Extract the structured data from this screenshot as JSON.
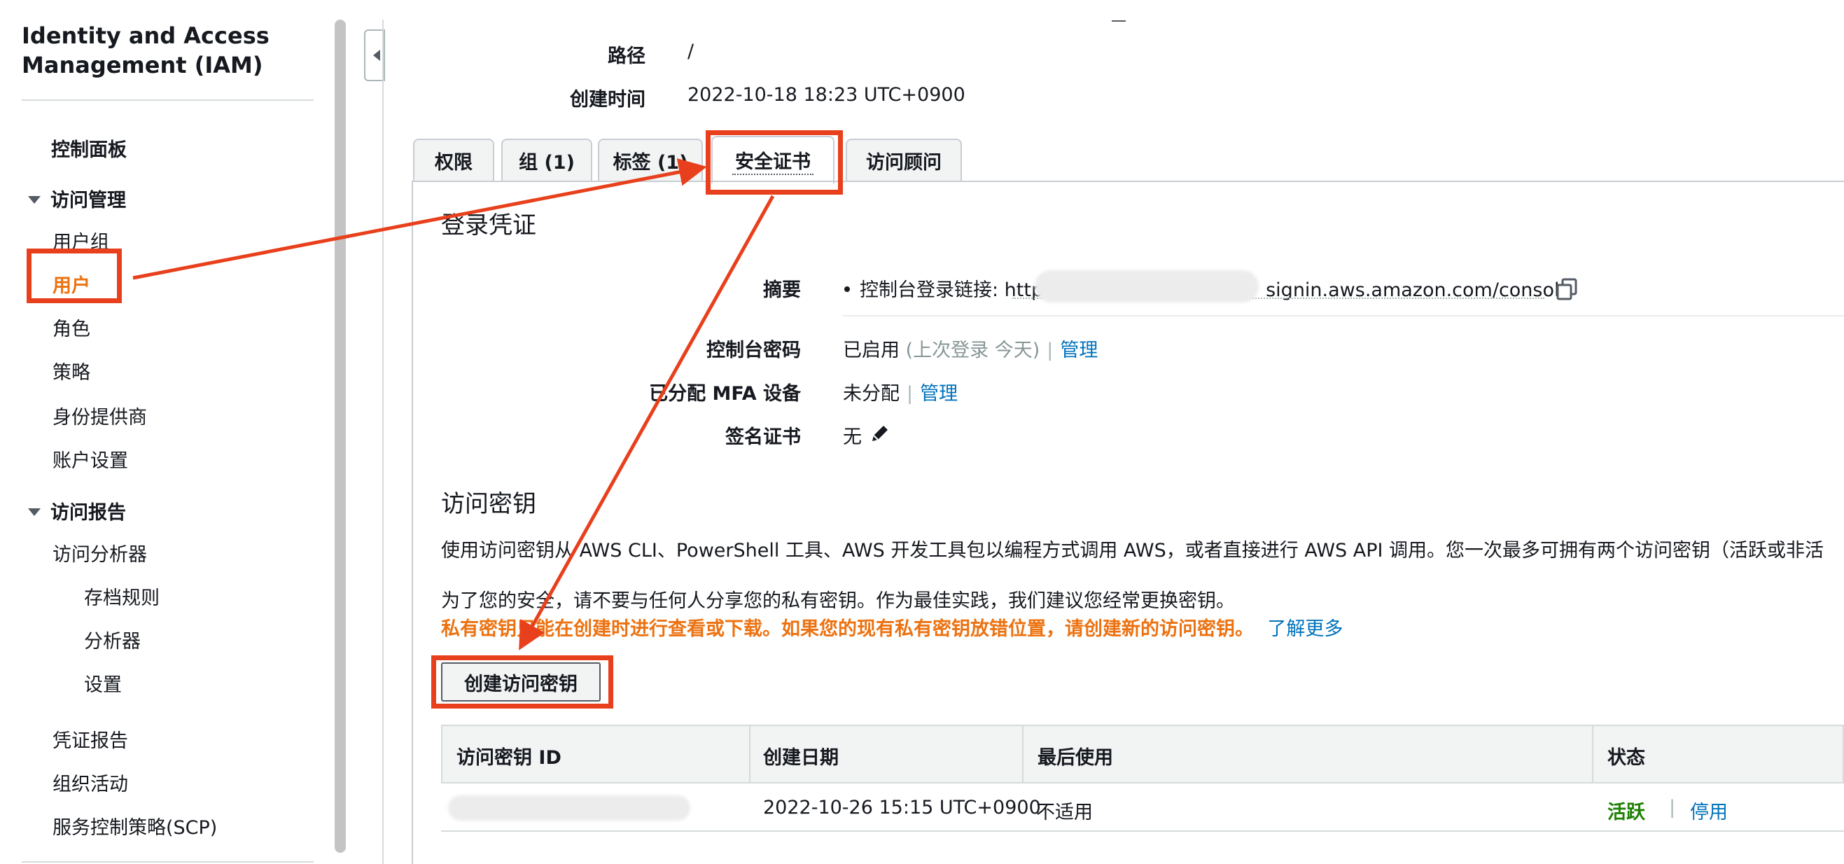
{
  "sidebar": {
    "title_line1": "Identity and Access",
    "title_line2": "Management (IAM)",
    "dashboard": "控制面板",
    "access_management": "访问管理",
    "user_groups": "用户组",
    "users": "用户",
    "roles": "角色",
    "policies": "策略",
    "identity_providers": "身份提供商",
    "account_settings": "账户设置",
    "access_reports": "访问报告",
    "access_analyzer": "访问分析器",
    "archive_rules": "存档规则",
    "analyzers": "分析器",
    "settings": "设置",
    "credential_report": "凭证报告",
    "org_activity": "组织活动",
    "scp": "服务控制策略(SCP)"
  },
  "details": {
    "path_label": "路径",
    "path_value": "/",
    "created_label": "创建时间",
    "created_value": "2022-10-18 18:23 UTC+0900"
  },
  "tabs": [
    {
      "label": "权限"
    },
    {
      "label": "组 (1)"
    },
    {
      "label": "标签 (1)"
    },
    {
      "label": "安全证书"
    },
    {
      "label": "访问顾问"
    }
  ],
  "login_credentials": {
    "heading": "登录凭证",
    "summary_label": "摘要",
    "summary_prefix": "控制台登录链接: http",
    "summary_suffix": "signin.aws.amazon.com/console",
    "console_password_label": "控制台密码",
    "console_password_value": "已启用",
    "console_password_note": "(上次登录 今天)",
    "manage": "管理",
    "sep": "|",
    "mfa_label": "已分配 MFA 设备",
    "mfa_value": "未分配",
    "signing_cert_label": "签名证书",
    "signing_cert_value": "无"
  },
  "access_keys": {
    "heading": "访问密钥",
    "desc": "使用访问密钥从 AWS CLI、PowerShell 工具、AWS 开发工具包以编程方式调用 AWS，或者直接进行 AWS API 调用。您一次最多可拥有两个访问密钥（活跃或非活",
    "security_note": "为了您的安全，请不要与任何人分享您的私有密钥。作为最佳实践，我们建议您经常更换密钥。",
    "warning": "私有密钥只能在创建时进行查看或下载。如果您的现有私有密钥放错位置，请创建新的访问密钥。",
    "learn_more": "了解更多",
    "create_button": "创建访问密钥",
    "columns": [
      "访问密钥 ID",
      "创建日期",
      "最后使用",
      "状态"
    ],
    "rows": [
      {
        "created": "2022-10-26 15:15 UTC+0900",
        "last_used": "不适用",
        "status": "活跃",
        "action": "停用"
      }
    ]
  },
  "annotation_color": "#e8401c"
}
